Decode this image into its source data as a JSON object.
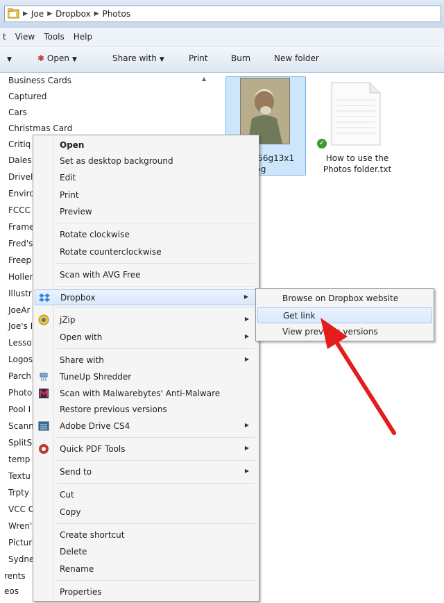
{
  "address": {
    "crumbs": [
      "Joe",
      "Dropbox",
      "Photos"
    ]
  },
  "menubar": [
    "t",
    "View",
    "Tools",
    "Help"
  ],
  "toolbar": {
    "open": "Open",
    "share_with": "Share with",
    "print": "Print",
    "burn": "Burn",
    "new_folder": "New folder"
  },
  "nav": {
    "items": [
      "Business Cards",
      "Captured",
      "Cars",
      "Christmas Card",
      "Critiq",
      "Dales",
      "Drivel",
      "Enviro",
      "FCCC",
      "Frame",
      "Fred's",
      "Freep",
      "Holler",
      "Illustr",
      "JoeAr",
      "Joe's I",
      "Lesso",
      "Logos",
      "Parch",
      "Photo",
      "Pool I",
      "Scann",
      "SplitS",
      "temp",
      "Textu",
      "Trpty",
      "VCC C",
      "Wren'",
      "Pictur",
      "Sydne",
      "rents",
      "eos"
    ]
  },
  "files": {
    "photo_name_line1": "2056g13x1",
    "photo_name_line2": ".jpg",
    "txt_name_line1": "How to use the",
    "txt_name_line2": "Photos folder.txt"
  },
  "context_menu": {
    "open": "Open",
    "set_desktop": "Set as desktop background",
    "edit": "Edit",
    "print": "Print",
    "preview": "Preview",
    "rotate_cw": "Rotate clockwise",
    "rotate_ccw": "Rotate counterclockwise",
    "scan_avg": "Scan with AVG Free",
    "dropbox": "Dropbox",
    "jzip": "jZip",
    "open_with": "Open with",
    "share_with": "Share with",
    "tuneup": "TuneUp Shredder",
    "malwarebytes": "Scan with Malwarebytes' Anti-Malware",
    "restore": "Restore previous versions",
    "adobe_drive": "Adobe Drive CS4",
    "quick_pdf": "Quick PDF Tools",
    "send_to": "Send to",
    "cut": "Cut",
    "copy": "Copy",
    "create_shortcut": "Create shortcut",
    "delete": "Delete",
    "rename": "Rename",
    "properties": "Properties"
  },
  "submenu": {
    "browse": "Browse on Dropbox website",
    "get_link": "Get link",
    "view_prev": "View previous versions"
  },
  "colors": {
    "highlight": "#d9e8fb",
    "arrow": "#e51c1c",
    "selection": "#cde6fb"
  }
}
